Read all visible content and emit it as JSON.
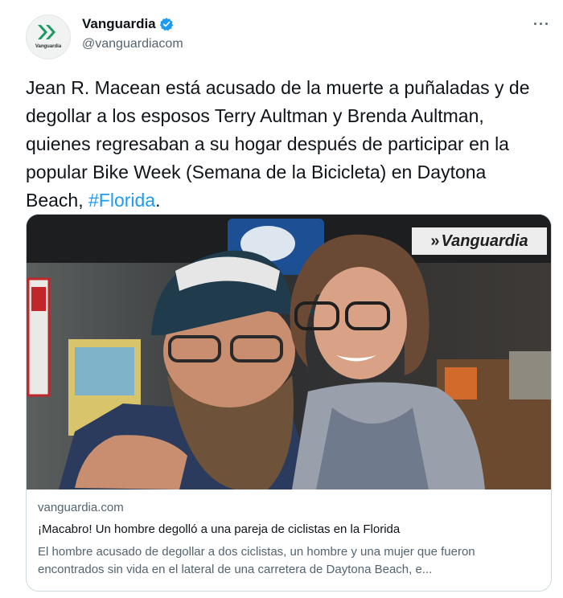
{
  "tweet": {
    "avatar_text": "Vanguardia",
    "display_name": "Vanguardia",
    "handle": "@vanguardiacom",
    "more_label": "···",
    "text_before": "Jean R. Macean está acusado de la muerte a puñaladas y de degollar a los esposos Terry Aultman y Brenda Aultman, quienes regresaban a su hogar después de participar en la popular Bike Week (Semana de la Bicicleta) en Daytona Beach, ",
    "hashtag": "#Florida",
    "text_after": ".",
    "icons": {
      "avatar": "vanguardia-logo",
      "verified": "verified-badge-icon",
      "more": "more-options-icon"
    },
    "colors": {
      "accent": "#1d9bf0",
      "verified": "#1d9bf0",
      "logo_green": "#1f9a63"
    }
  },
  "card": {
    "watermark": "Vanguardia",
    "watermark_mark": "»",
    "domain": "vanguardia.com",
    "title": "¡Macabro! Un hombre degolló a una pareja de ciclistas en la Florida",
    "description": "El hombre acusado de degollar a dos ciclistas, un hombre y una mujer que fueron encontrados sin vida en el lateral de una carretera de Daytona Beach, e..."
  }
}
